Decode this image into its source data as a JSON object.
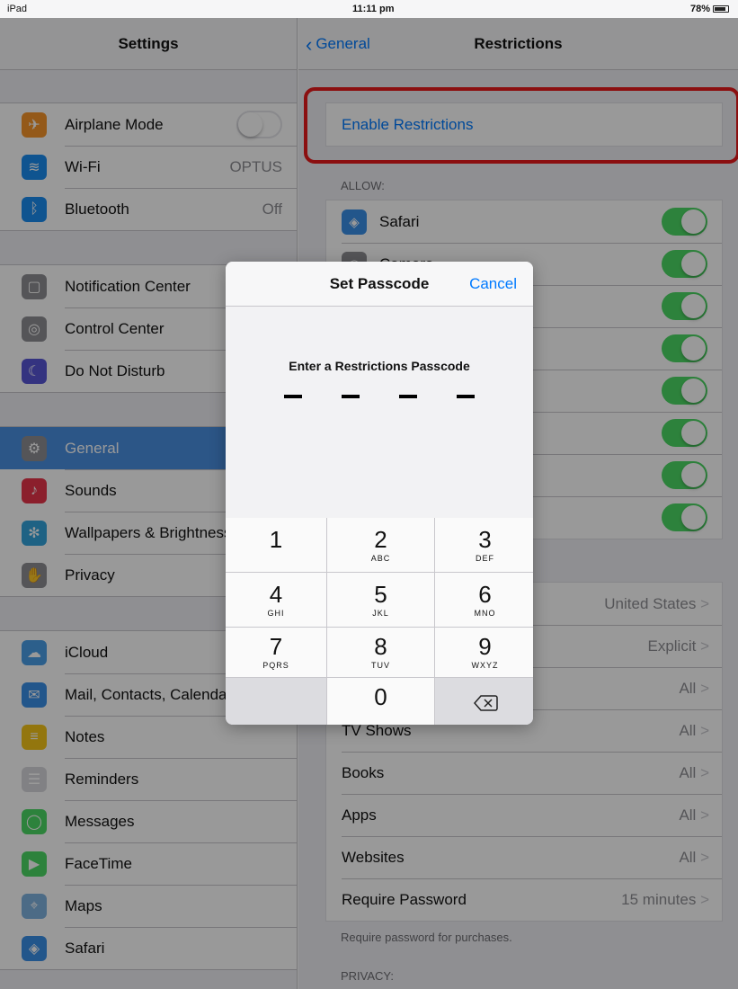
{
  "status_bar": {
    "carrier": "iPad",
    "time": "11:11 pm",
    "battery": "78%"
  },
  "left_pane": {
    "title": "Settings",
    "groups": [
      [
        {
          "label": "Airplane Mode",
          "icon": "airplane-icon",
          "color": "#f7952a",
          "glyph": "✈",
          "toggle": "off"
        },
        {
          "label": "Wi-Fi",
          "icon": "wifi-icon",
          "color": "#1a8cf0",
          "glyph": "≋",
          "value": "OPTUS"
        },
        {
          "label": "Bluetooth",
          "icon": "bluetooth-icon",
          "color": "#1a8cf0",
          "glyph": "ᛒ",
          "value": "Off"
        }
      ],
      [
        {
          "label": "Notification Center",
          "icon": "notification-center-icon",
          "color": "#8e8e93",
          "glyph": "▢"
        },
        {
          "label": "Control Center",
          "icon": "control-center-icon",
          "color": "#8e8e93",
          "glyph": "◎"
        },
        {
          "label": "Do Not Disturb",
          "icon": "moon-icon",
          "color": "#5856d6",
          "glyph": "☾"
        }
      ],
      [
        {
          "label": "General",
          "icon": "gear-icon",
          "color": "#8e8e93",
          "glyph": "⚙",
          "selected": true
        },
        {
          "label": "Sounds",
          "icon": "speaker-icon",
          "color": "#e8344a",
          "glyph": "♪"
        },
        {
          "label": "Wallpapers & Brightness",
          "icon": "wallpaper-icon",
          "color": "#33a3dc",
          "glyph": "✻"
        },
        {
          "label": "Privacy",
          "icon": "hand-icon",
          "color": "#8e8e93",
          "glyph": "✋"
        }
      ],
      [
        {
          "label": "iCloud",
          "icon": "cloud-icon",
          "color": "#4a9fe8",
          "glyph": "☁"
        },
        {
          "label": "Mail, Contacts, Calendars",
          "icon": "mail-icon",
          "color": "#3a8fe8",
          "glyph": "✉"
        },
        {
          "label": "Notes",
          "icon": "notes-icon",
          "color": "#f5c518",
          "glyph": "≡"
        },
        {
          "label": "Reminders",
          "icon": "reminders-icon",
          "color": "#d8d8dc",
          "glyph": "☰"
        },
        {
          "label": "Messages",
          "icon": "messages-icon",
          "color": "#4cd964",
          "glyph": "◯"
        },
        {
          "label": "FaceTime",
          "icon": "facetime-icon",
          "color": "#4cd964",
          "glyph": "▶"
        },
        {
          "label": "Maps",
          "icon": "maps-icon",
          "color": "#7fb3e0",
          "glyph": "⌖"
        },
        {
          "label": "Safari",
          "icon": "safari-icon",
          "color": "#3a8fe8",
          "glyph": "◈"
        }
      ]
    ]
  },
  "right_pane": {
    "back_label": "General",
    "title": "Restrictions",
    "enable_label": "Enable Restrictions",
    "allow_header": "ALLOW:",
    "allow_items": [
      {
        "label": "Safari",
        "icon": "safari-icon",
        "color": "#3a8fe8",
        "glyph": "◈"
      },
      {
        "label": "Camera",
        "icon": "camera-icon",
        "color": "#8e8e93",
        "glyph": "◉"
      },
      {
        "label": "",
        "icon": "",
        "color": "",
        "glyph": ""
      },
      {
        "label": "",
        "icon": "",
        "color": "",
        "glyph": ""
      },
      {
        "label": "",
        "icon": "",
        "color": "",
        "glyph": ""
      },
      {
        "label": "",
        "icon": "",
        "color": "",
        "glyph": ""
      },
      {
        "label": "",
        "icon": "",
        "color": "",
        "glyph": ""
      },
      {
        "label": "",
        "icon": "",
        "color": "",
        "glyph": ""
      }
    ],
    "content_items": [
      {
        "label": "",
        "value": "United States"
      },
      {
        "label": "",
        "value": "Explicit"
      },
      {
        "label": "",
        "value": "All"
      },
      {
        "label": "TV Shows",
        "value": "All"
      },
      {
        "label": "Books",
        "value": "All"
      },
      {
        "label": "Apps",
        "value": "All"
      },
      {
        "label": "Websites",
        "value": "All"
      },
      {
        "label": "Require Password",
        "value": "15 minutes"
      }
    ],
    "footer_note": "Require password for purchases.",
    "privacy_header": "PRIVACY:"
  },
  "passcode_popover": {
    "title": "Set Passcode",
    "cancel_label": "Cancel",
    "prompt": "Enter a Restrictions Passcode",
    "keys": [
      {
        "digit": "1",
        "letters": ""
      },
      {
        "digit": "2",
        "letters": "ABC"
      },
      {
        "digit": "3",
        "letters": "DEF"
      },
      {
        "digit": "4",
        "letters": "GHI"
      },
      {
        "digit": "5",
        "letters": "JKL"
      },
      {
        "digit": "6",
        "letters": "MNO"
      },
      {
        "digit": "7",
        "letters": "PQRS"
      },
      {
        "digit": "8",
        "letters": "TUV"
      },
      {
        "digit": "9",
        "letters": "WXYZ"
      },
      {
        "digit": "0",
        "letters": ""
      }
    ]
  },
  "colors": {
    "accent": "#007aff",
    "toggle_on": "#4cd964",
    "highlight": "#e8191c",
    "selected_row": "#4a90e2"
  }
}
